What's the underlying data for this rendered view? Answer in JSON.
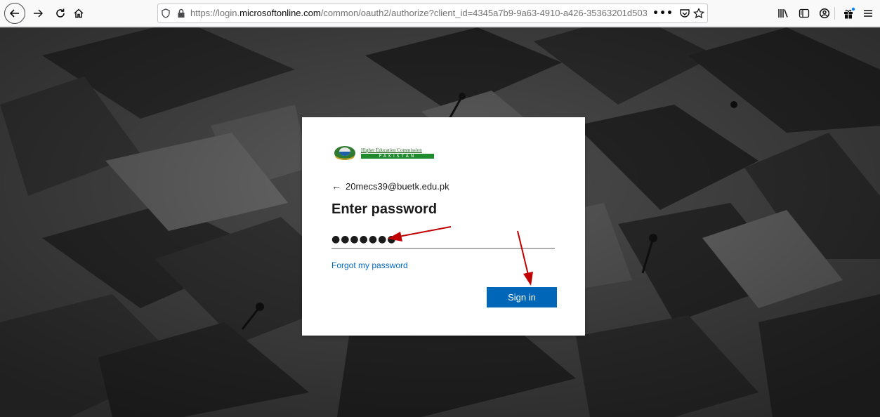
{
  "browser": {
    "url": {
      "host": "https://login.",
      "domain": "microsoftonline.com",
      "path": "/common/oauth2/authorize?client_id=4345a7b9-9a63-4910-a426-35363201d503",
      "more_actions": "•••"
    },
    "icons": {
      "back": "back-arrow-icon",
      "forward": "forward-arrow-icon",
      "reload": "reload-icon",
      "home": "home-icon",
      "tracking": "shield-icon",
      "secure": "lock-icon",
      "pocket": "pocket-icon",
      "bookmark": "star-icon",
      "library": "library-icon",
      "sidebar": "sidebar-icon",
      "account": "account-icon",
      "whats_new": "gift-icon",
      "menu": "hamburger-menu-icon"
    }
  },
  "login": {
    "logo": {
      "org_name": "Higher Education Commission",
      "country": "PAKISTAN"
    },
    "identity": {
      "arrow": "←",
      "email": "20mecs39@buetk.edu.pk"
    },
    "title": "Enter password",
    "password_value": "●●●●●●●",
    "forgot_link": "Forgot my password",
    "sign_in_button": "Sign in"
  },
  "colors": {
    "button_blue": "#0067b8",
    "link_blue": "#0067b8",
    "annotation_arrow": "#c00000",
    "hec_green": "#1f8a2e"
  }
}
